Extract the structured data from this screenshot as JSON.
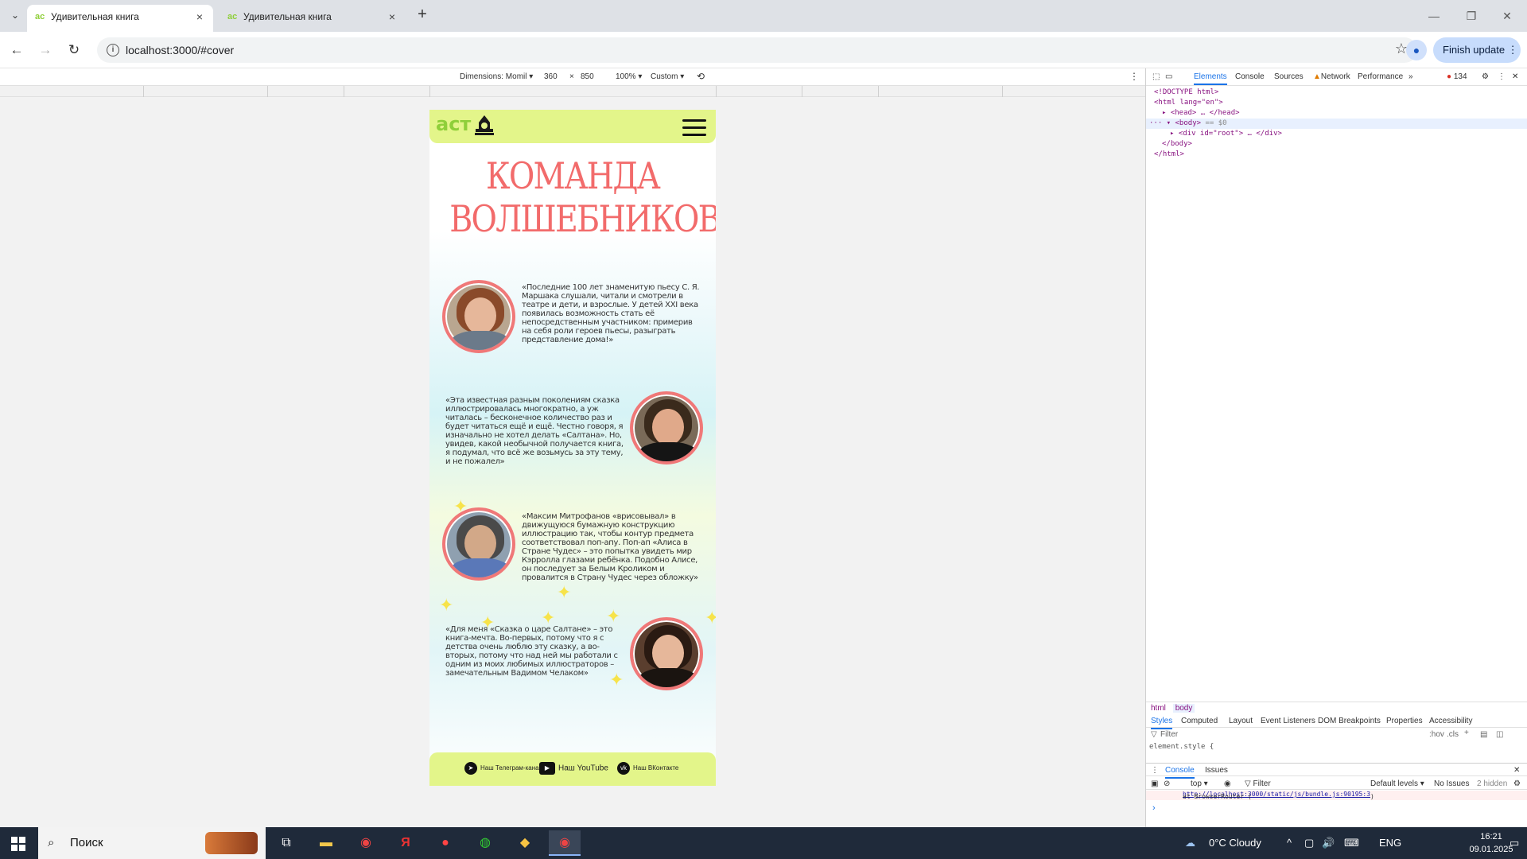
{
  "browser": {
    "tabs": [
      {
        "title": "Удивительная книга",
        "active": true
      },
      {
        "title": "Удивительная книга",
        "active": false
      }
    ],
    "url": "localhost:3000/#cover",
    "finish_update": "Finish update"
  },
  "device_toolbar": {
    "dimensions_label": "Dimensions: Momil",
    "width": "360",
    "times": "×",
    "height": "850",
    "zoom": "100%",
    "throttle": "Custom"
  },
  "page": {
    "logo_text": "аст",
    "title_line1": "КОМАНДА",
    "title_line2": "ВОЛШЕБНИКОВ",
    "people": [
      {
        "quote": "«Последние 100 лет знаменитую пьесу С. Я. Маршака слушали, читали и смотрели в театре и дети, и взрослые. У детей XXI века появилась возможность стать её непосредственным участником: примерив на себя роли героев пьесы, разыграть представление дома!»"
      },
      {
        "quote": "«Эта известная разным поколениям сказка иллюстрировалась многократно, а уж читалась – бесконечное количество раз и будет читаться ещё и ещё. Честно говоря, я изначально не хотел делать «Салтана». Но, увидев, какой необычной получается книга, я подумал, что всё же возьмусь за эту тему, и не пожалел»"
      },
      {
        "quote": "«Максим Митрофанов «врисовывал» в движущуюся бумажную конструкцию иллюстрацию так, чтобы контур предмета соответствовал поп-апу. Поп-ап «Алиса в Стране Чудес» – это попытка увидеть мир Кэрролла глазами ребёнка. Подобно Алисе, он последует за Белым Кроликом и провалится в Страну Чудес через обложку»"
      },
      {
        "quote": "«Для меня «Сказка о царе Салтане» – это книга-мечта. Во-первых, потому что я с детства очень люблю эту сказку, а во-вторых, потому что над ней мы работали с одним из моих любимых иллюстраторов – замечательным Вадимом Челаком»"
      }
    ],
    "footer": {
      "telegram": "Наш Телеграм-канал",
      "youtube": "Наш YouTube",
      "vk": "Наш ВКонтакте"
    }
  },
  "devtools": {
    "tabs": [
      "Elements",
      "Console",
      "Sources",
      "Network",
      "Performance"
    ],
    "error_count": "134",
    "dom": {
      "doctype": "<!DOCTYPE html>",
      "html_open": "<html lang=\"en\">",
      "head": "<head>",
      "head_close": "</head>",
      "body_open": "<body>",
      "body_marker": "== $0",
      "div_root": "<div id=\"root\">",
      "div_close": "</div>",
      "body_close": "</body>",
      "html_close": "</html>"
    },
    "crumbs": [
      "html",
      "body"
    ],
    "sub_tabs": [
      "Styles",
      "Computed",
      "Layout",
      "Event Listeners",
      "DOM Breakpoints",
      "Properties",
      "Accessibility"
    ],
    "filter_placeholder": "Filter",
    "hov": ":hov",
    "cls": ".cls",
    "element_style": "element.style {",
    "drawer_tabs": [
      "Console",
      "Issues"
    ],
    "context": "top",
    "levels": "Default levels",
    "no_issues": "No Issues",
    "hidden": "2 hidden",
    "error_text": "at BrowserRouter (",
    "error_link": "http://localhost:3000/static/js/bundle.js:90195:3",
    "error_close": ")"
  },
  "taskbar": {
    "search": "Поиск",
    "weather": "0°C  Cloudy",
    "lang": "ENG",
    "time": "16:21",
    "date": "09.01.2025"
  }
}
